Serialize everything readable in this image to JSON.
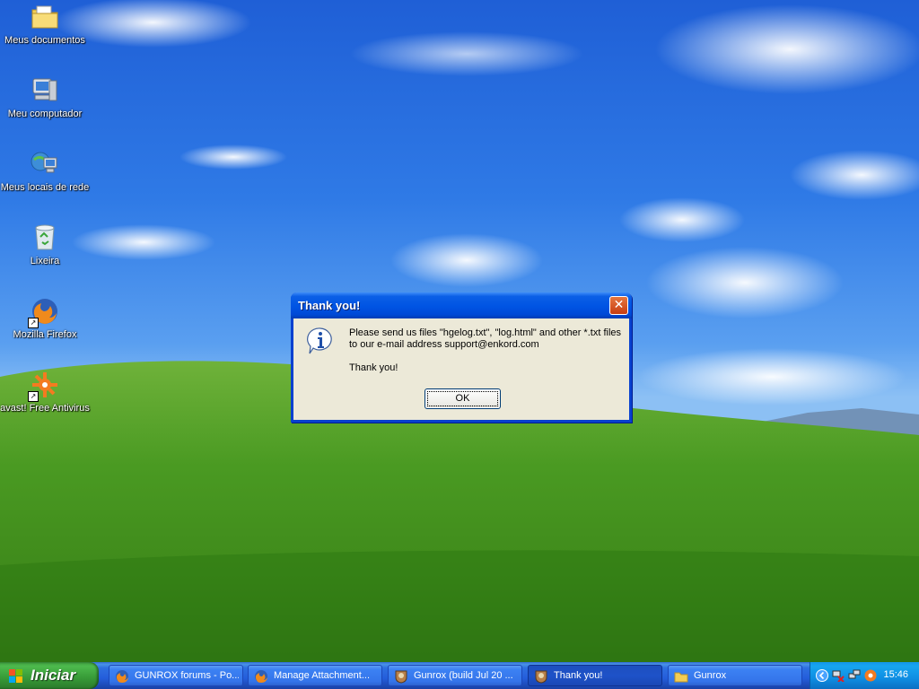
{
  "desktop": {
    "icons": [
      {
        "label": "Meus documentos",
        "icon": "folder-documents-icon"
      },
      {
        "label": "Meu computador",
        "icon": "computer-icon"
      },
      {
        "label": "Meus locais de rede",
        "icon": "network-places-icon"
      },
      {
        "label": "Lixeira",
        "icon": "recycle-bin-icon"
      },
      {
        "label": "Mozilla Firefox",
        "icon": "firefox-icon"
      },
      {
        "label": "avast! Free Antivirus",
        "icon": "avast-icon"
      }
    ]
  },
  "dialog": {
    "title": "Thank you!",
    "close_glyph": "✕",
    "icon": "info-icon",
    "message_line1": "Please send us files \"hgelog.txt\", \"log.html\" and other *.txt files to our e-mail address support@enkord.com",
    "message_line2": "Thank you!",
    "ok_label": "OK"
  },
  "taskbar": {
    "start_label": "Iniciar",
    "tasks": [
      {
        "label": "GUNROX forums - Po...",
        "icon": "firefox-icon",
        "active": false
      },
      {
        "label": "Manage Attachment...",
        "icon": "firefox-icon",
        "active": false
      },
      {
        "label": "Gunrox (build Jul 20 ...",
        "icon": "gunrox-icon",
        "active": false
      },
      {
        "label": "Thank you!",
        "icon": "gunrox-icon",
        "active": true
      },
      {
        "label": "Gunrox",
        "icon": "folder-icon",
        "active": false
      }
    ],
    "tray": {
      "clock": "15:46",
      "icons": [
        "show-hidden-icons-chevron",
        "network-error-icon",
        "network-icon",
        "avast-tray-icon"
      ]
    }
  },
  "colors": {
    "title_blue": "#0054e3",
    "dialog_face": "#ece9d8",
    "start_green": "#3d9a3d",
    "taskbar_blue": "#245ddb"
  }
}
